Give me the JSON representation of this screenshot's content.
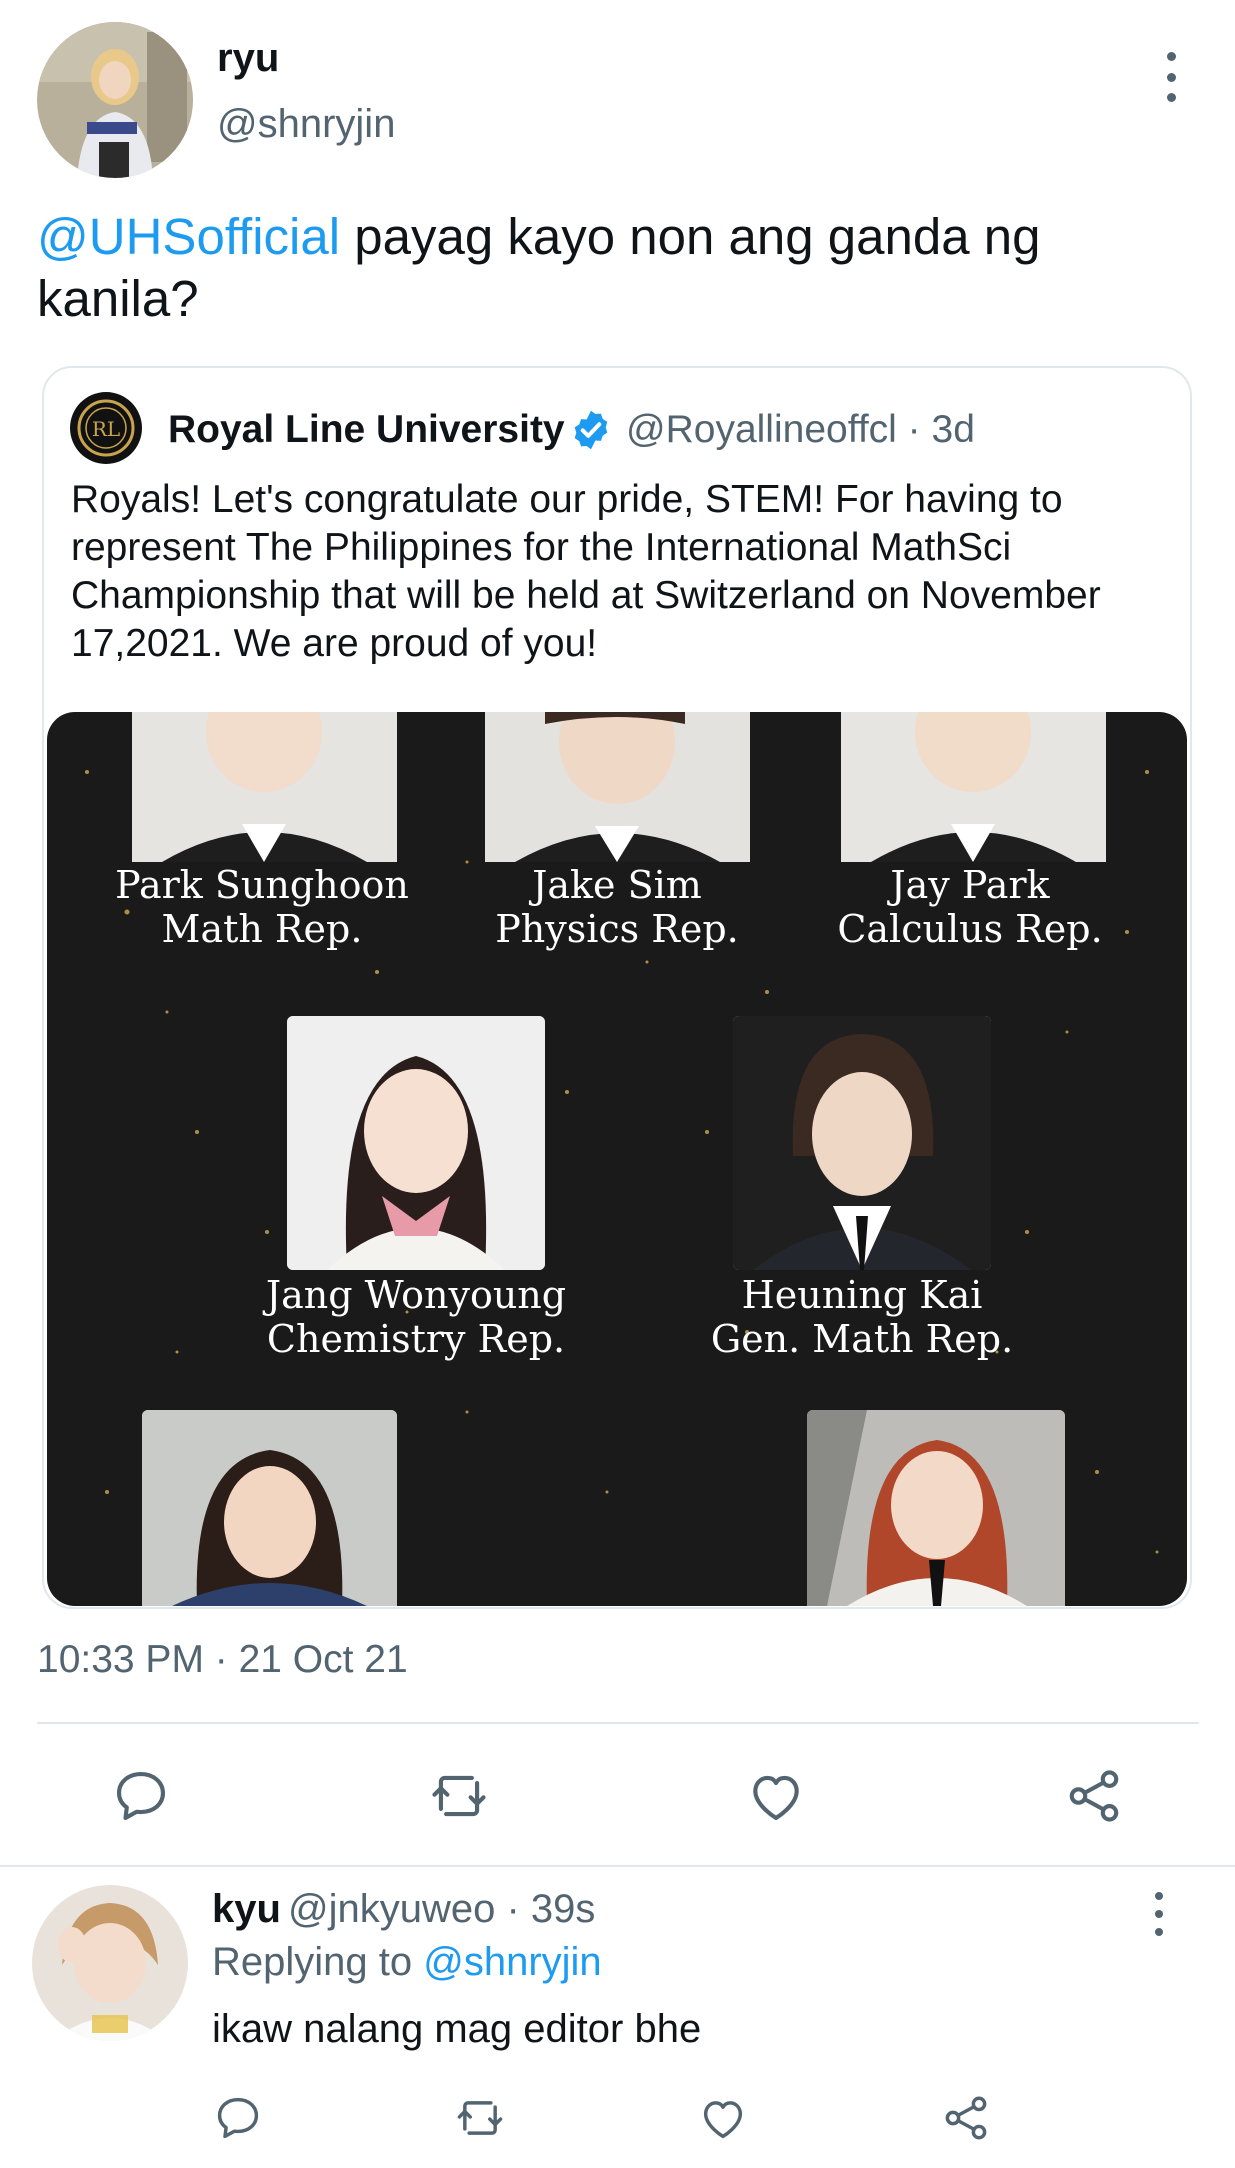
{
  "main_tweet": {
    "author_name": "ryu",
    "author_handle": "@shnryjin",
    "mention": "@UHSofficial",
    "text_rest": " payag kayo non ang ganda ng kanila?",
    "timestamp": "10:33 PM · 21 Oct 21"
  },
  "quote_tweet": {
    "author_name": "Royal Line University",
    "author_handle": "@Royallineoffcl",
    "age": "3d",
    "text": "Royals! Let's congratulate our pride, STEM! For having to represent The Philippines for the International MathSci Championship that will be held at Switzerland on November 17,2021. We are proud of you!",
    "image_captions": {
      "c1": [
        "Park Sunghoon",
        "Math Rep."
      ],
      "c2": [
        "Jake Sim",
        "Physics Rep."
      ],
      "c3": [
        "Jay Park",
        "Calculus Rep."
      ],
      "c4": [
        "Jang Wonyoung",
        "Chemistry Rep."
      ],
      "c5": [
        "Heuning Kai",
        "Gen. Math Rep."
      ]
    }
  },
  "actions": [
    "reply-icon",
    "retweet-icon",
    "like-icon",
    "share-icon"
  ],
  "reply": {
    "author_name": "kyu",
    "author_handle": "@jnkyuweo",
    "age": "39s",
    "replying_prefix": "Replying to ",
    "replying_to": "@shnryjin",
    "text": "ikaw nalang mag editor bhe"
  },
  "colors": {
    "accent": "#1d9bf0",
    "secondary_text": "#536471",
    "divider": "#e1e8ed",
    "image_bg": "#1a1a1a"
  }
}
